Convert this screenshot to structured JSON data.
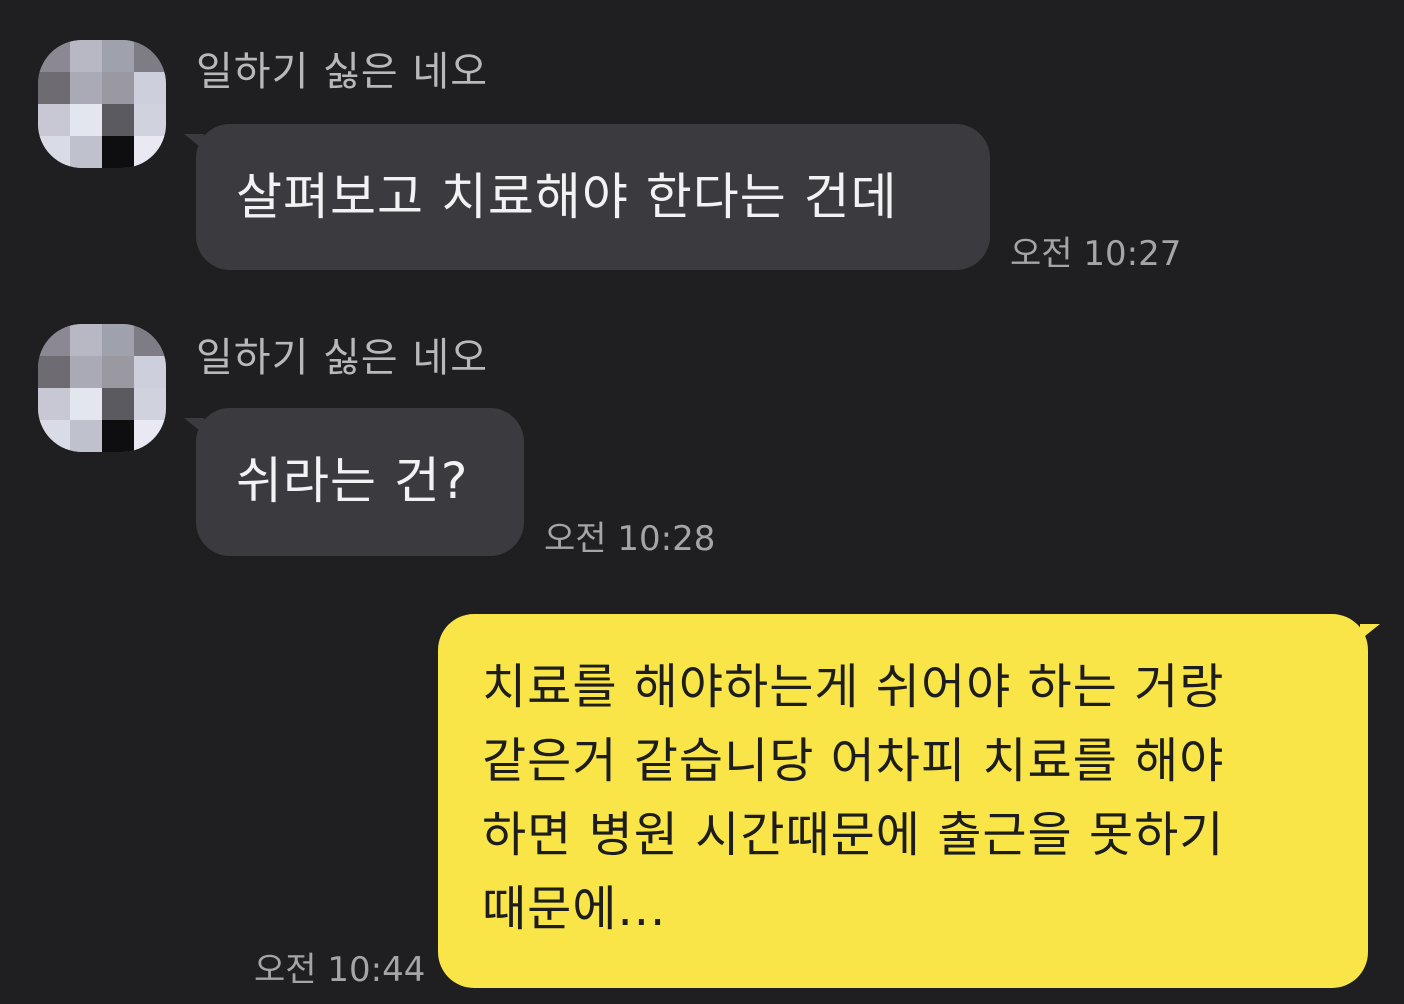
{
  "messages": [
    {
      "direction": "received",
      "sender": "일하기 싫은 네오",
      "text": "살펴보고 치료해야 한다는 건데",
      "time": "오전 10:27"
    },
    {
      "direction": "received",
      "sender": "일하기 싫은 네오",
      "text": "쉬라는 건?",
      "time": "오전 10:28"
    },
    {
      "direction": "sent",
      "text": "치료를 해야하는게 쉬어야 하는 거랑\n같은거 같습니당 어차피 치료를 해야\n하면 병원 시간때문에 출근을 못하기\n때문에...",
      "time": "오전 10:44"
    }
  ],
  "colors": {
    "background": "#1f1f21",
    "received_bubble": "#3b3b3f",
    "sent_bubble": "#f9e548",
    "timestamp": "#a4a4a9",
    "sender_name": "#b8b8bc"
  }
}
